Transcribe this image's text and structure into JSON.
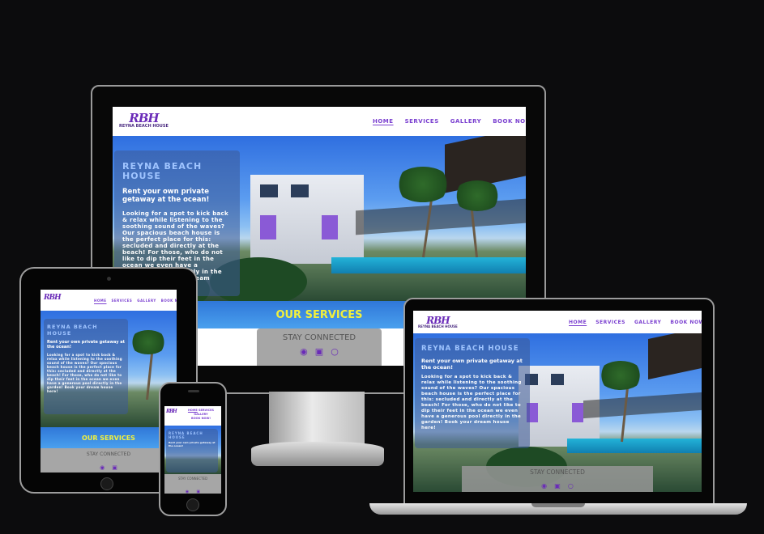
{
  "site": {
    "logo_mark": "RBH",
    "logo_text": "REYNA BEACH HOUSE",
    "nav": {
      "home": "HOME",
      "services": "SERVICES",
      "gallery": "GALLERY",
      "book": "BOOK NOW!"
    },
    "hero_title_short": "REYNA BEACH HOUSE",
    "hero_subtitle": "Rent your own private getaway at the ocean!",
    "hero_body": "Looking for a spot to kick back & relax while listening to the soothing sound of the waves? Our spacious beach house is the perfect place for this: secluded and directly at the beach! For those, who do not like to dip their feet in the ocean we even have a generous pool directly in the garden! Book your dream house here!",
    "services_heading": "OUR SERVICES",
    "footer_heading": "STAY CONNECTED",
    "footer_icons": [
      "facebook-icon",
      "instagram-icon",
      "twitter-icon"
    ]
  },
  "colors": {
    "nav_link": "#7a3fd0",
    "services_heading": "#f2f03c",
    "background": "#0c0c0d"
  }
}
